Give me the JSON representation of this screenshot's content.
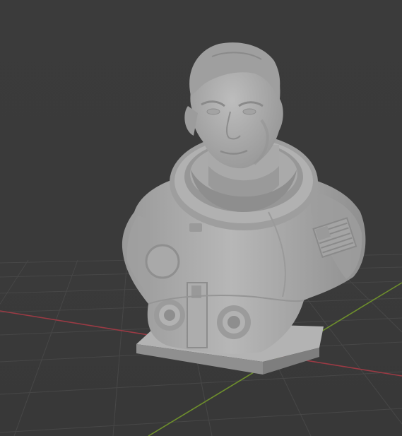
{
  "viewport": {
    "mode": "3D Viewport",
    "object": "astronaut-bust",
    "colors": {
      "background": "#3a3a3a",
      "grid": "#454545",
      "x_axis": "#9b3a44",
      "y_axis": "#6e8f2c",
      "clay": "#a6a6a6"
    }
  }
}
